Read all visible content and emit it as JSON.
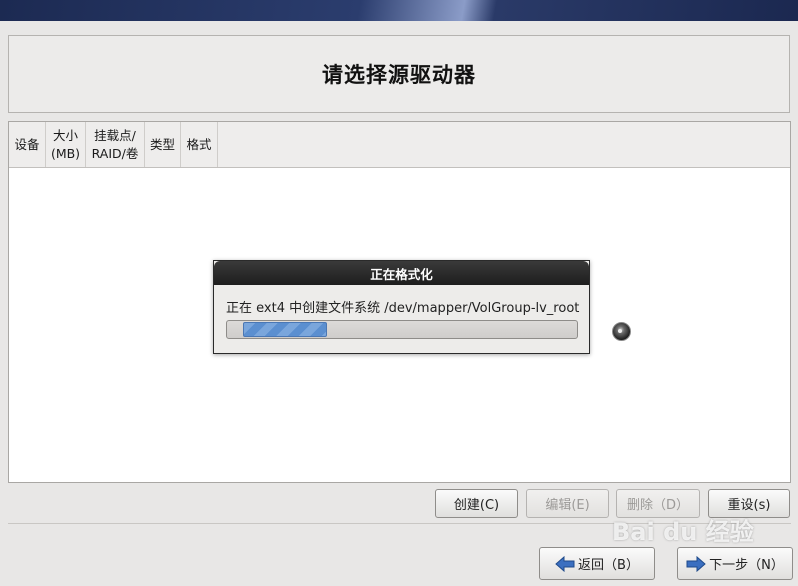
{
  "page": {
    "title": "请选择源驱动器"
  },
  "table": {
    "columns": [
      {
        "label": "设备"
      },
      {
        "label": "大小\n(MB)"
      },
      {
        "label": "挂载点/\nRAID/卷"
      },
      {
        "label": "类型"
      },
      {
        "label": "格式"
      }
    ]
  },
  "dialog": {
    "title": "正在格式化",
    "message": "正在 ext4 中创建文件系统 /dev/mapper/VolGroup-lv_root",
    "progress_fraction": 0.25
  },
  "buttons": {
    "create": "创建(C)",
    "edit": "编辑(E)",
    "delete": "删除（D）",
    "reset": "重设(s)",
    "back": "返回（B）",
    "next": "下一步（N）"
  },
  "icons": {
    "back_arrow": "arrow-left-icon",
    "next_arrow": "arrow-right-icon",
    "busy": "spinner-icon"
  },
  "colors": {
    "progress_fill": "#6b9ad6",
    "dialog_header": "#262626",
    "arrow": "#3b6fc0"
  },
  "watermark": {
    "text": "Bai du 经验"
  }
}
